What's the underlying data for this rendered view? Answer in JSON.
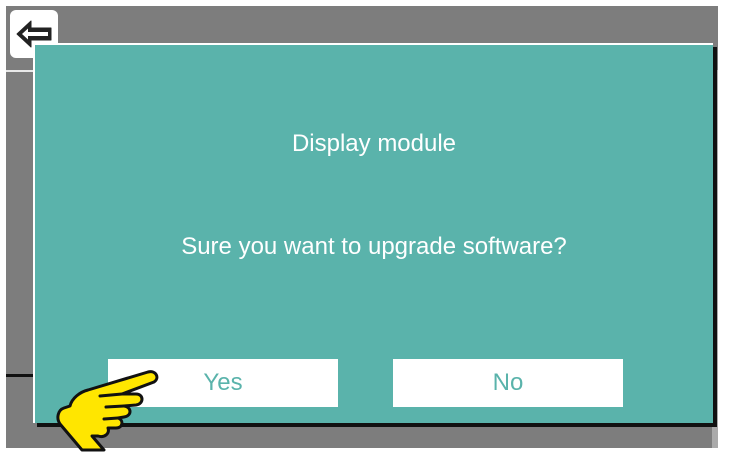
{
  "background_screen": {
    "back_button_icon": "arrow-left-icon"
  },
  "dialog": {
    "title": "Display module",
    "message": "Sure you want to upgrade software?",
    "yes_label": "Yes",
    "no_label": "No"
  },
  "overlay": {
    "pointer_icon": "pointing-hand-icon"
  },
  "colors": {
    "dialog_bg": "#5ab3ab",
    "button_bg": "#ffffff",
    "button_text": "#5ab3ab",
    "dimmed_screen": "#7d7d7d",
    "hand_fill": "#ffe600"
  }
}
